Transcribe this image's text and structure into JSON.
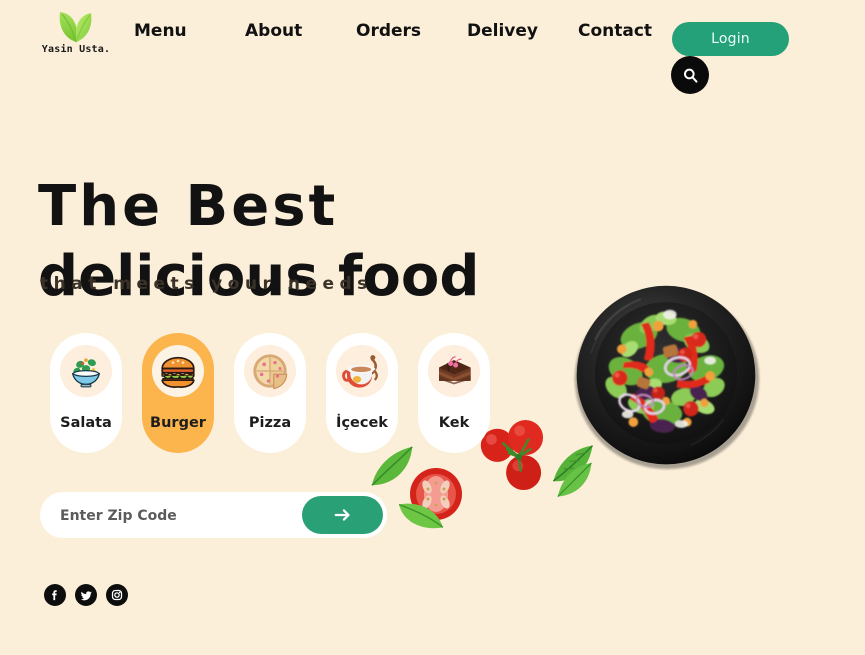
{
  "brand": {
    "logo_icon": "leaf-icon",
    "name": "Yasin Usta.",
    "leaf_color": "#8ed14a"
  },
  "nav": {
    "items": [
      {
        "label": "Menu"
      },
      {
        "label": "About"
      },
      {
        "label": "Orders"
      },
      {
        "label": "Delivey"
      },
      {
        "label": "Contact"
      }
    ]
  },
  "header": {
    "login_label": "Login",
    "login_color": "#24a179",
    "search_icon": "search-icon",
    "search_bg": "#0a0a0a"
  },
  "hero": {
    "line1": "The Best",
    "line2": "delicious food",
    "subtitle": "that meets your needs"
  },
  "categories": [
    {
      "label": "Salata",
      "icon": "salad-bowl-icon",
      "active": false
    },
    {
      "label": "Burger",
      "icon": "burger-icon",
      "active": true
    },
    {
      "label": "Pizza",
      "icon": "pizza-icon",
      "active": false
    },
    {
      "label": "İçecek",
      "icon": "drink-cup-icon",
      "active": false
    },
    {
      "label": "Kek",
      "icon": "cake-slice-icon",
      "active": false
    }
  ],
  "zip": {
    "placeholder": "Enter Zip Code",
    "value": "",
    "submit_icon": "arrow-right-icon",
    "submit_color": "#2aa077"
  },
  "social": [
    {
      "name": "facebook-icon"
    },
    {
      "name": "twitter-icon"
    },
    {
      "name": "instagram-icon"
    }
  ],
  "imagery": {
    "plate": "salad-plate-photo",
    "decorations": [
      "tomato-half",
      "tomato-cluster",
      "basil-leaf",
      "basil-leaf",
      "basil-leaf",
      "basil-leaf"
    ]
  },
  "theme": {
    "background": "#fcefd9",
    "accent_green": "#24a179",
    "accent_orange": "#fcb44c",
    "text": "#121212"
  }
}
